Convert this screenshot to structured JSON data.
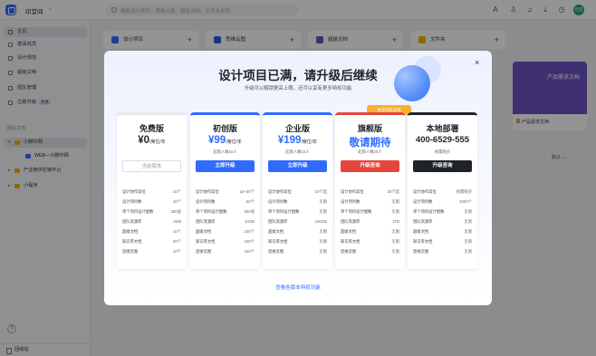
{
  "topbar": {
    "workspace": "印堂间",
    "search_placeholder": "搜索设计项目、思维云图、超级文档、文件夹名称",
    "avatar": "印堂"
  },
  "sidebar": {
    "nav": [
      {
        "label": "主页",
        "icon": "home-icon"
      },
      {
        "label": "邀请成员",
        "icon": "users-icon"
      },
      {
        "label": "设计规范",
        "icon": "ruler-icon"
      },
      {
        "label": "超级文档",
        "icon": "doc-icon"
      },
      {
        "label": "团队管理",
        "icon": "team-icon"
      },
      {
        "label": "立即升级",
        "icon": "upgrade-icon",
        "badge": "免费"
      }
    ],
    "section_title": "团队文件",
    "tree": [
      {
        "label": "小脚印网"
      },
      {
        "label": "WEB—小脚印网"
      },
      {
        "label": "产业链供应链平台"
      },
      {
        "label": "小程序"
      }
    ],
    "help": "?",
    "trash": "回收站"
  },
  "main": {
    "quick_actions": [
      {
        "label": "设计项目",
        "color": "#3b6cf6"
      },
      {
        "label": "思维云图",
        "color": "#2d5bd8"
      },
      {
        "label": "超级文档",
        "color": "#6b52c7"
      },
      {
        "label": "文件夹",
        "color": "#f4b400"
      }
    ],
    "bg_card_title": "产品需求文档",
    "bg_card_name": "产品需求文档",
    "sort_label": "默认"
  },
  "modal": {
    "title": "设计项目已满，请升级后继续",
    "subtitle": "升级可以解锁更高上限，还可以享有更多特权功能",
    "close": "×",
    "flag": "更多团队选择",
    "plans": [
      {
        "name": "免费版",
        "price": "¥0",
        "unit": "/席位/年",
        "note": "",
        "button": "当前版本",
        "accent": "#e6e8eb",
        "price_color": "#1f2329",
        "features": [
          {
            "label": "设计协作席位",
            "value": "10个"
          },
          {
            "label": "设计项目数",
            "value": "10个"
          },
          {
            "label": "单个项目设计图数",
            "value": "300张"
          },
          {
            "label": "团队资源库",
            "value": "0GB"
          },
          {
            "label": "超级文档",
            "value": "10个"
          },
          {
            "label": "知识库文档",
            "value": "20个"
          },
          {
            "label": "思维云图",
            "value": "10个"
          }
        ]
      },
      {
        "name": "初创版",
        "price": "¥99",
        "unit": "/席位/年",
        "note": "起购人数10人",
        "button": "立即升级",
        "accent": "#2f6bff",
        "price_color": "#2f6bff",
        "features": [
          {
            "label": "设计协作席位",
            "value": "10~20个"
          },
          {
            "label": "设计项目数",
            "value": "50个"
          },
          {
            "label": "单个项目设计图数",
            "value": "300张"
          },
          {
            "label": "团队资源库",
            "value": "10GB"
          },
          {
            "label": "超级文档",
            "value": "100个"
          },
          {
            "label": "知识库文档",
            "value": "100个"
          },
          {
            "label": "思维云图",
            "value": "100个"
          }
        ]
      },
      {
        "name": "企业版",
        "price": "¥199",
        "unit": "/席位/年",
        "note": "起购人数10人",
        "button": "立即升级",
        "accent": "#2f6bff",
        "price_color": "#2f6bff",
        "features": [
          {
            "label": "设计协作席位",
            "value": "10个起"
          },
          {
            "label": "设计项目数",
            "value": "无限"
          },
          {
            "label": "单个项目设计图数",
            "value": "无限"
          },
          {
            "label": "团队资源库",
            "value": "100GB"
          },
          {
            "label": "超级文档",
            "value": "无限"
          },
          {
            "label": "知识库文档",
            "value": "无限"
          },
          {
            "label": "思维云图",
            "value": "无限"
          }
        ]
      },
      {
        "name": "旗舰版",
        "price": "敬请期待",
        "unit": "",
        "note": "起购人数20人",
        "button": "升级咨询",
        "accent": "#e5463b",
        "price_color": "#2f6bff",
        "features": [
          {
            "label": "设计协作席位",
            "value": "20个起"
          },
          {
            "label": "设计项目数",
            "value": "无限"
          },
          {
            "label": "单个项目设计图数",
            "value": "无限"
          },
          {
            "label": "团队资源库",
            "value": "1TB"
          },
          {
            "label": "超级文档",
            "value": "无限"
          },
          {
            "label": "知识库文档",
            "value": "无限"
          },
          {
            "label": "思维云图",
            "value": "无限"
          }
        ]
      },
      {
        "name": "本地部署",
        "price": "400-6529-555",
        "unit": "",
        "note": "按需购买",
        "button": "升级咨询",
        "accent": "#1f2329",
        "price_color": "#1f2329",
        "features": [
          {
            "label": "设计协作席位",
            "value": "按需购买"
          },
          {
            "label": "设计项目数",
            "value": "1000个"
          },
          {
            "label": "单个项目设计图数",
            "value": "无限"
          },
          {
            "label": "团队资源库",
            "value": "无限"
          },
          {
            "label": "超级文档",
            "value": "无限"
          },
          {
            "label": "知识库文档",
            "value": "无限"
          },
          {
            "label": "思维云图",
            "value": "无限"
          }
        ]
      }
    ],
    "compare_link": "查看各版本特权功能"
  }
}
